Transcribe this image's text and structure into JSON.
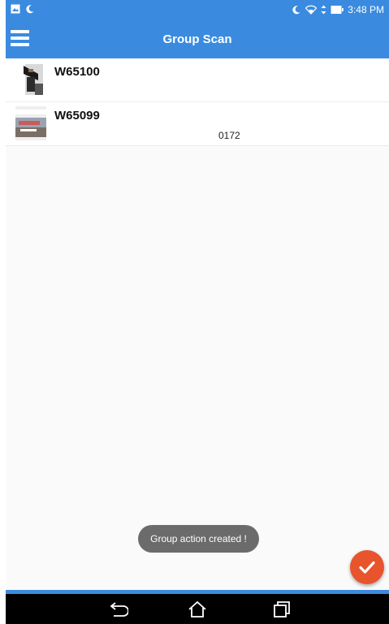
{
  "status_bar": {
    "time": "3:48 PM",
    "icons": [
      "gallery-icon",
      "moon-icon",
      "moon-icon",
      "wifi-icon",
      "data-arrows-icon",
      "battery-icon"
    ]
  },
  "app_bar": {
    "title": "Group Scan",
    "menu_icon": "hamburger-menu-icon"
  },
  "list": {
    "items": [
      {
        "title": "W65100",
        "subtitle": ""
      },
      {
        "title": "W65099",
        "subtitle": "0172"
      }
    ]
  },
  "toast": {
    "message": "Group action created !"
  },
  "fab": {
    "icon": "check-icon",
    "color": "#e8542c"
  },
  "nav_bar": {
    "icons": [
      "back-icon",
      "home-icon",
      "recent-apps-icon"
    ]
  },
  "colors": {
    "primary": "#3a8be0",
    "accent": "#e8542c",
    "toast_bg": "#6b6b6b"
  }
}
